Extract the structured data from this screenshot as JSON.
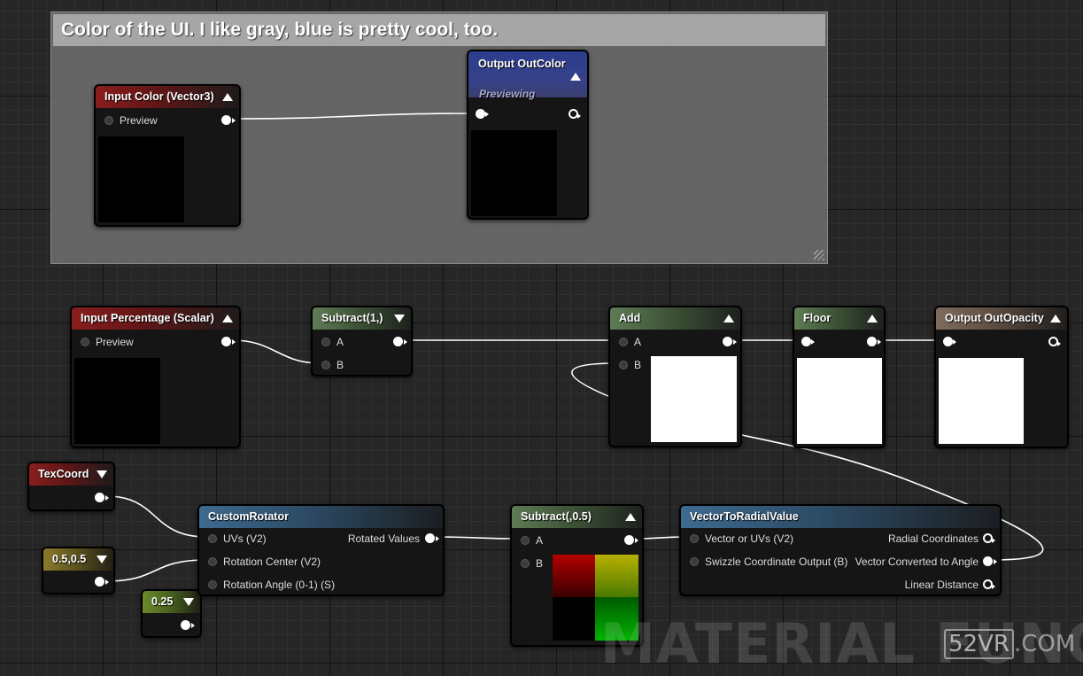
{
  "comment_box": {
    "title": "Color of the UI. I like gray, blue is pretty cool, too."
  },
  "nodes": {
    "input_color": {
      "title": "Input Color (Vector3)",
      "pin_preview": "Preview"
    },
    "output_outcolor": {
      "title": "Output OutColor",
      "status": "Previewing"
    },
    "input_percentage": {
      "title": "Input Percentage (Scalar)",
      "pin_preview": "Preview"
    },
    "subtract_1": {
      "title": "Subtract(1,)",
      "pin_a": "A",
      "pin_b": "B"
    },
    "add": {
      "title": "Add",
      "pin_a": "A",
      "pin_b": "B"
    },
    "floor": {
      "title": "Floor"
    },
    "output_outopacity": {
      "title": "Output OutOpacity"
    },
    "texcoord": {
      "title": "TexCoord"
    },
    "const_05": {
      "title": "0.5,0.5"
    },
    "const_025": {
      "title": "0.25"
    },
    "custom_rotator": {
      "title": "CustomRotator",
      "in_uvs": "UVs (V2)",
      "in_center": "Rotation Center (V2)",
      "in_angle": "Rotation Angle (0-1) (S)",
      "out_rotated": "Rotated Values"
    },
    "subtract_05": {
      "title": "Subtract(,0.5)",
      "pin_a": "A",
      "pin_b": "B"
    },
    "vector_to_radial": {
      "title": "VectorToRadialValue",
      "in_vector": "Vector or UVs (V2)",
      "in_swizzle": "Swizzle Coordinate Output (B)",
      "out_radial": "Radial Coordinates",
      "out_angle": "Vector Converted to Angle",
      "out_linear": "Linear Distance"
    }
  },
  "watermark": {
    "text": "MATERIAL FUNCTION",
    "brand_box": "52VR",
    "brand_suffix": ".COM"
  },
  "colors": {
    "canvas": "#262626",
    "input_header": "#8a1d1d",
    "math_header": "#5e7c55",
    "function_header": "#3e6a8f",
    "output_header": "#806b5c",
    "preview_header": "#2b3d8c",
    "wire": "#ffffff"
  }
}
